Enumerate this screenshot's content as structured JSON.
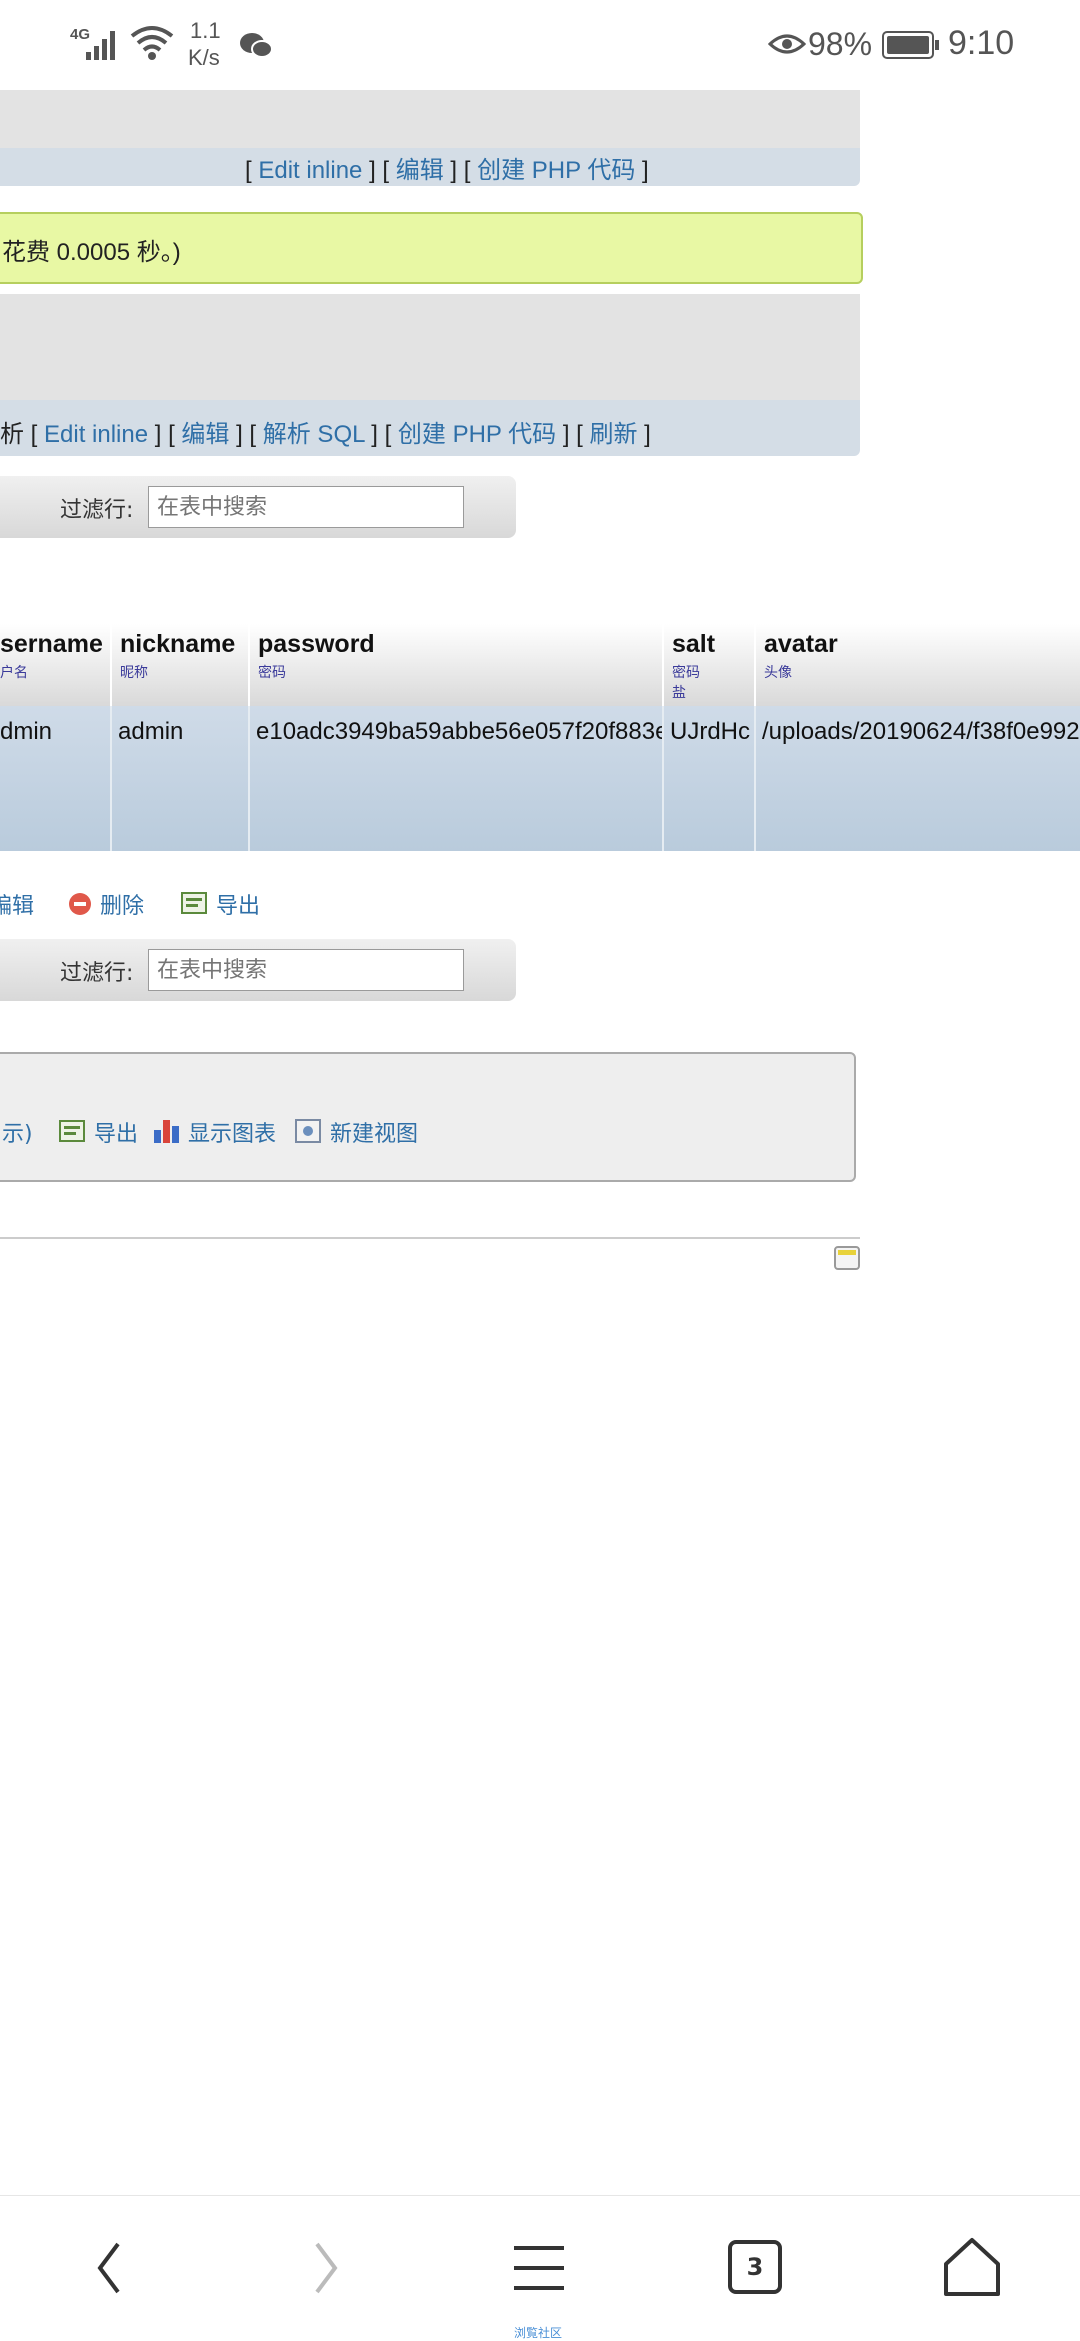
{
  "status_bar": {
    "network": "4G",
    "speed_value": "1.1",
    "speed_unit": "K/s",
    "battery": "98%",
    "time": "9:10"
  },
  "query_actions": {
    "edit_inline": "Edit inline",
    "edit": "编辑",
    "create_php": "创建 PHP 代码"
  },
  "success_message": "花费 0.0005 秒。)",
  "sql_actions": {
    "prefix": "析",
    "edit_inline": "Edit inline",
    "edit": "编辑",
    "explain_sql": "解析 SQL",
    "create_php": "创建 PHP 代码",
    "refresh": "刷新"
  },
  "filter_top": {
    "label": "过滤行:",
    "placeholder": "在表中搜索"
  },
  "table": {
    "columns": [
      {
        "title": "sername",
        "sub": "户名"
      },
      {
        "title": "nickname",
        "sub": "昵称"
      },
      {
        "title": "password",
        "sub": "密码"
      },
      {
        "title": "salt",
        "sub": "密码",
        "sub2": "盐"
      },
      {
        "title": "avatar",
        "sub": "头像"
      }
    ],
    "row": [
      "dmin",
      "admin",
      "e10adc3949ba59abbe56e057f20f883e",
      "UJrdHc",
      "/uploads/20190624/f38f0e992"
    ]
  },
  "row_actions": {
    "edit": "编辑",
    "delete": "删除",
    "export": "导出"
  },
  "filter_bottom": {
    "label": "过滤行:",
    "placeholder": "在表中搜索"
  },
  "query_ops": {
    "prefix": "示)",
    "export": "导出",
    "chart": "显示图表",
    "create_view": "新建视图"
  },
  "nav": {
    "tabs_count": "3",
    "caption": "浏覧社区"
  },
  "colors": {
    "link": "#2f6fa7",
    "success_bg": "#e8f8a4",
    "row_bg": "#c2d2e2"
  }
}
